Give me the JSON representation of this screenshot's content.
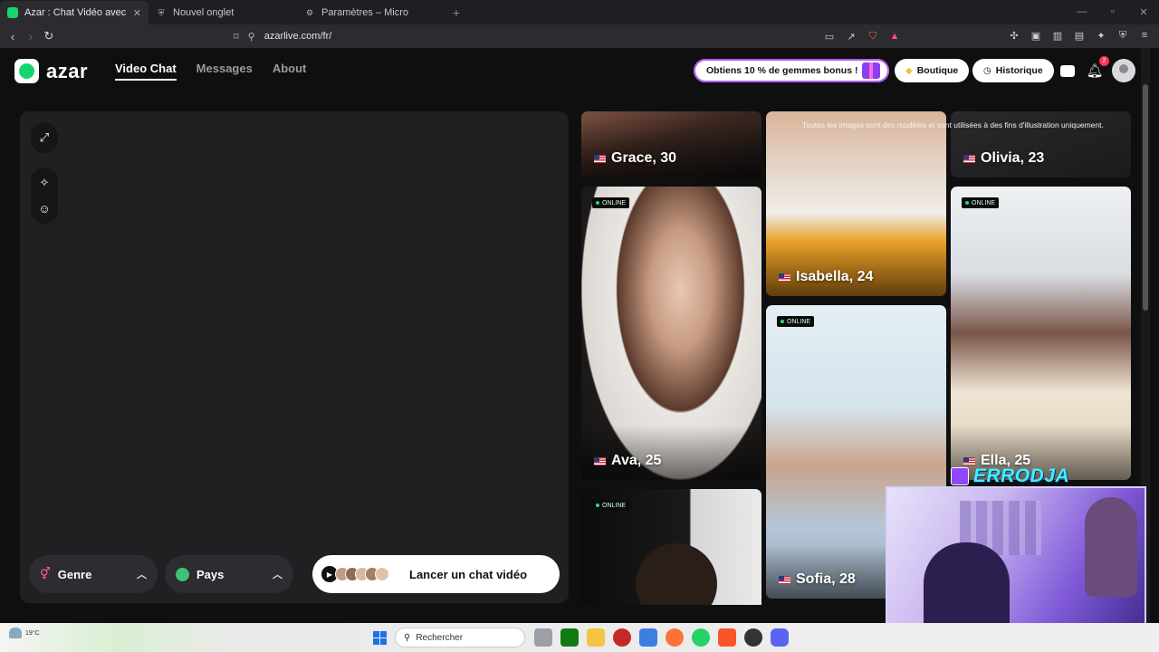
{
  "browser": {
    "tabs": [
      {
        "title": "Azar : Chat Vidéo avec de nouve",
        "favicon": "azar-icon",
        "active": true
      },
      {
        "title": "Nouvel onglet",
        "favicon": "shield-icon",
        "active": false
      },
      {
        "title": "Paramètres – Micro",
        "favicon": "gear-icon",
        "active": false
      }
    ],
    "url": "azarlive.com/fr/",
    "brave_badge": "2"
  },
  "header": {
    "logo": "azar",
    "nav": [
      {
        "label": "Video Chat",
        "active": true
      },
      {
        "label": "Messages",
        "active": false
      },
      {
        "label": "About",
        "active": false
      }
    ],
    "promo": "Obtiens 10 % de gemmes bonus !",
    "shop": "Boutique",
    "history": "Historique",
    "notif_count": "2"
  },
  "panel": {
    "gender": "Genre",
    "country": "Pays",
    "launch": "Lancer un chat vidéo"
  },
  "disclaimer": "Toutes les images sont des modèles et sont utilisées à des fins d'illustration uniquement.",
  "profiles": [
    {
      "name": "Grace, 30",
      "online": false
    },
    {
      "name": "Isabella, 24",
      "online": false
    },
    {
      "name": "Olivia, 23",
      "online": false
    },
    {
      "name": "Ava, 25",
      "online": true
    },
    {
      "name": "Sofia, 28",
      "online": true
    },
    {
      "name": "Ella, 25",
      "online": true
    },
    {
      "name": "",
      "online": true
    }
  ],
  "online_label": "ONLINE",
  "stream": {
    "tag": "ERRODJA"
  },
  "taskbar": {
    "temp": "19°C",
    "search": "Rechercher"
  },
  "colors": {
    "accent": "#16d46f",
    "promo_border": "#b25cf2",
    "online_dot": "#21e07a"
  }
}
